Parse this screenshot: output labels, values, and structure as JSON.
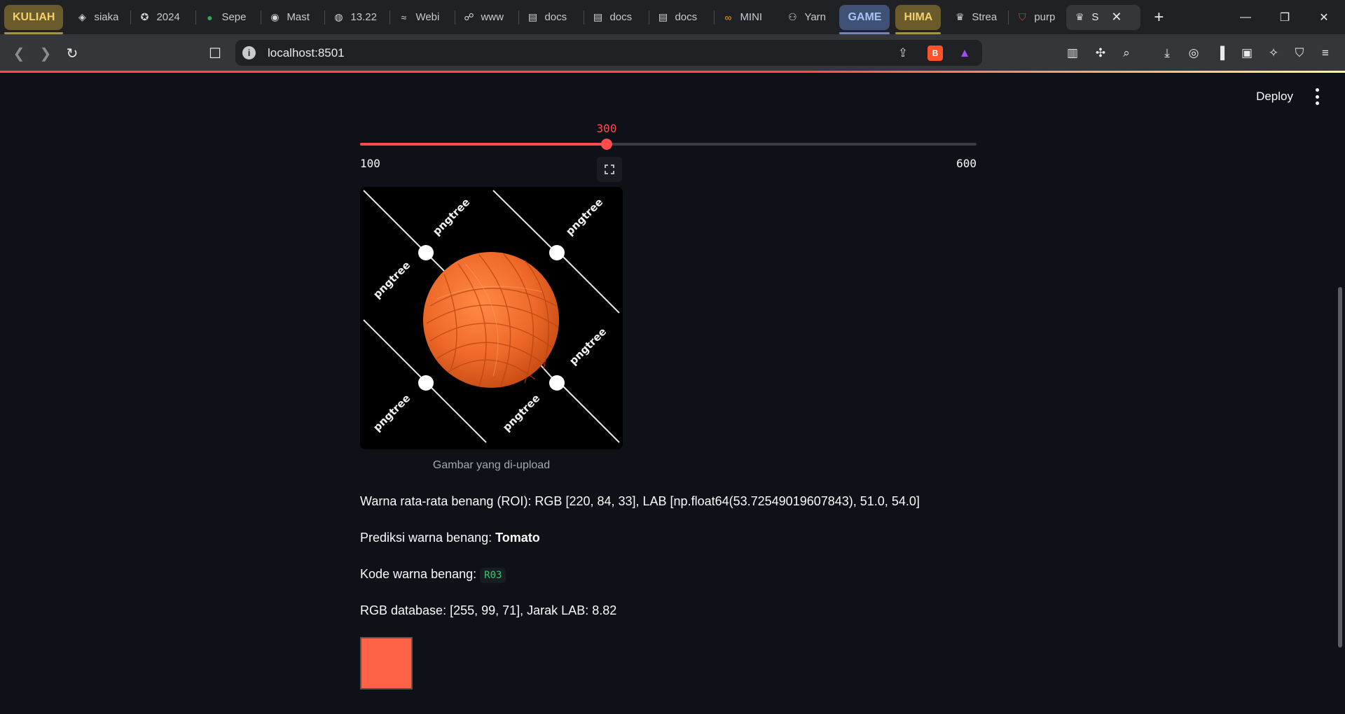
{
  "browser": {
    "tab_groups": {
      "kuliah": "KULIAH",
      "game": "GAME",
      "hima": "HIMA"
    },
    "tabs": [
      {
        "label": "siaka",
        "icon": "globe-icon"
      },
      {
        "label": "2024",
        "icon": "emblem-icon"
      },
      {
        "label": "Sepe",
        "icon": "flag-icon"
      },
      {
        "label": "Mast",
        "icon": "github-icon"
      },
      {
        "label": "13.22",
        "icon": "globe-icon"
      },
      {
        "label": "Webi",
        "icon": "webinar-icon"
      },
      {
        "label": "www",
        "icon": "runner-icon"
      },
      {
        "label": "docs",
        "icon": "doc-icon"
      },
      {
        "label": "docs",
        "icon": "doc-icon"
      },
      {
        "label": "docs",
        "icon": "doc-icon"
      },
      {
        "label": "MINI",
        "icon": "infinity-icon"
      },
      {
        "label": "Yarn",
        "icon": "copilot-icon"
      }
    ],
    "tabs_after_game": [
      {
        "label": "Strea",
        "icon": "streamlit-icon"
      },
      {
        "label": "purp",
        "icon": "shield-icon"
      }
    ],
    "active_tab": {
      "label": "S",
      "icon": "streamlit-icon"
    },
    "url": "localhost:8501"
  },
  "app": {
    "deploy_label": "Deploy",
    "slider": {
      "min": 100,
      "max": 600,
      "value": 300,
      "min_label": "100",
      "max_label": "600",
      "value_label": "300"
    },
    "image": {
      "caption": "Gambar yang di-upload",
      "watermark": "pngtree",
      "yarn_color": "#ef6a2a"
    },
    "result": {
      "avg_color_prefix": "Warna rata-rata benang (ROI): RGB [220, 84, 33], LAB [np.float64(53.72549019607843), 51.0, 54.0]",
      "prediction_prefix": "Prediksi warna benang: ",
      "prediction_value": "Tomato",
      "code_prefix": "Kode warna benang: ",
      "code_value": "R03",
      "db_line": "RGB database: [255, 99, 71], Jarak LAB: 8.82",
      "swatch_color": "#ff6347"
    }
  },
  "colors": {
    "accent": "#ff4b4b",
    "background": "#0e1117"
  }
}
